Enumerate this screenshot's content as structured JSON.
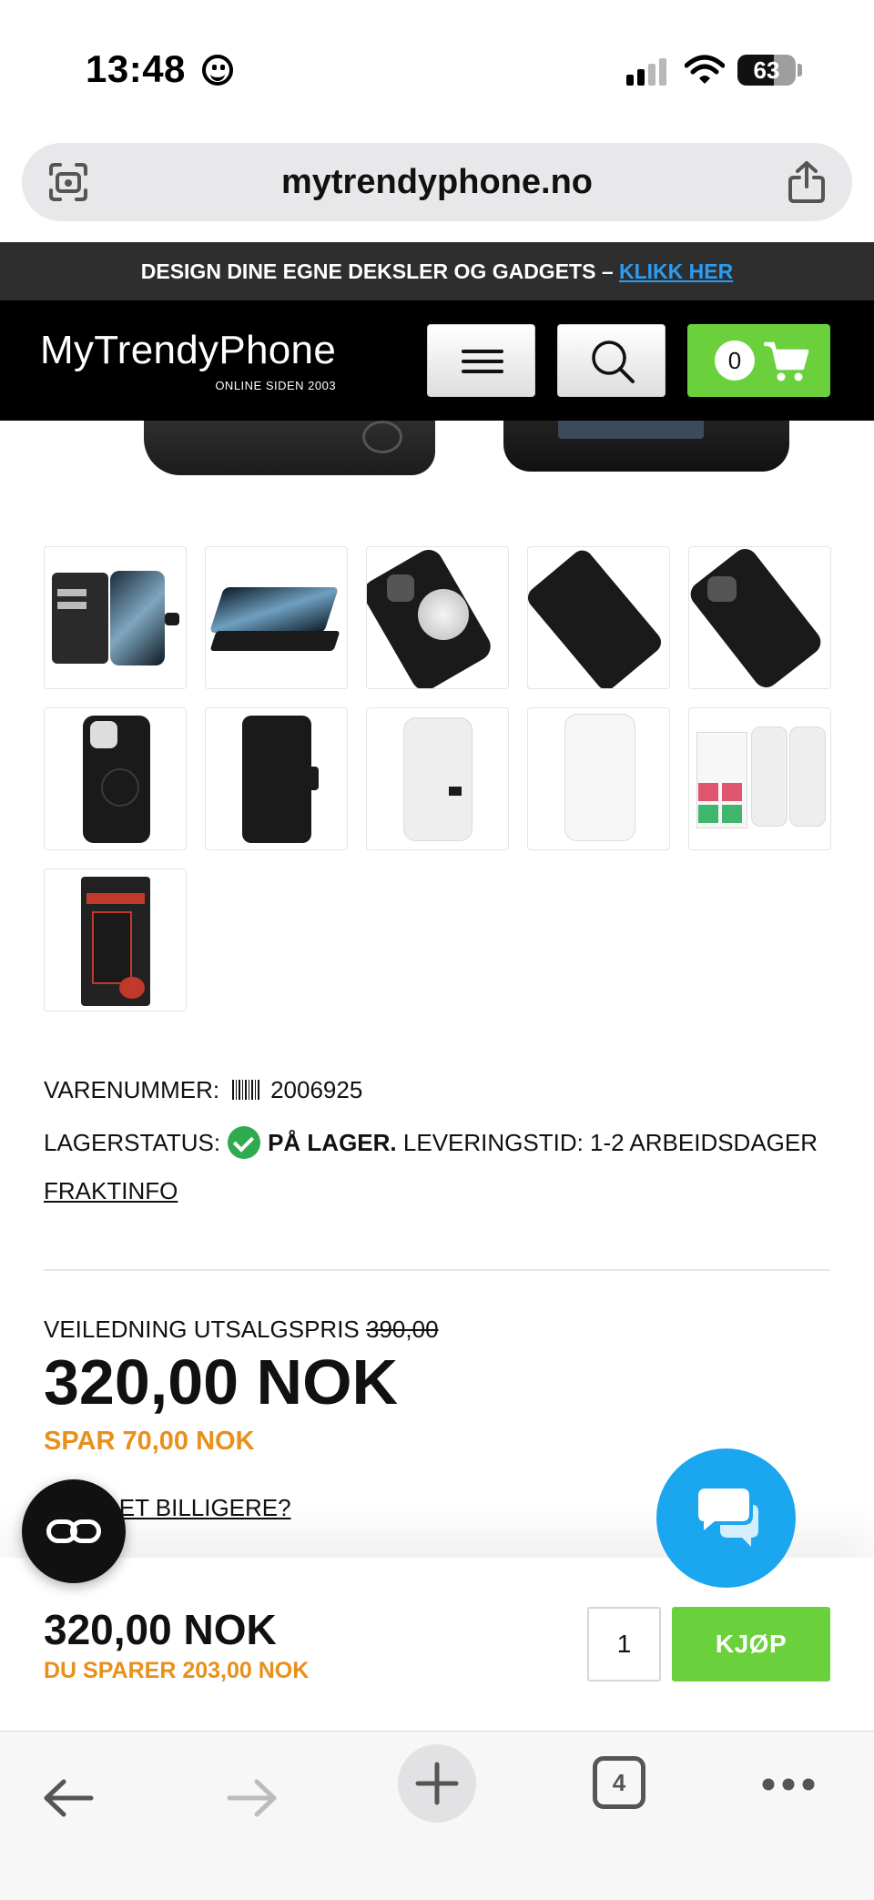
{
  "status_bar": {
    "time": "13:48",
    "battery": "63",
    "battery_level": 0.63
  },
  "browser": {
    "url": "mytrendyphone.no",
    "tab_count": "4"
  },
  "promo": {
    "text": "DESIGN DINE EGNE DEKSLER OG GADGETS – ",
    "link": "KLIKK HER"
  },
  "header": {
    "logo_name": "MyTrendyPhone",
    "logo_tagline": "ONLINE SIDEN 2003",
    "cart_count": "0"
  },
  "thumbnails": [
    {
      "icon": "wallet-open-cards"
    },
    {
      "icon": "wallet-stand"
    },
    {
      "icon": "case-magsafe"
    },
    {
      "icon": "wallet-closed"
    },
    {
      "icon": "case-back"
    },
    {
      "icon": "case-back-ring"
    },
    {
      "icon": "case-closed-front"
    },
    {
      "icon": "screen-protector"
    },
    {
      "icon": "screen-protector-peel"
    },
    {
      "icon": "protector-kit"
    },
    {
      "icon": "retail-box"
    }
  ],
  "product": {
    "sku_label": "VARENUMMER:",
    "sku": "2006925",
    "stock_label": "LAGERSTATUS:",
    "stock_status": "PÅ LAGER.",
    "delivery": "LEVERINGSTID: 1-2 ARBEIDSDAGER",
    "shipping_link": "FRAKTINFO",
    "rrp_label": "VEILEDNING UTSALGSPRIS",
    "rrp_price": "390,00",
    "price": "320,00 NOK",
    "save": "SPAR 70,00 NOK",
    "cheaper_link": "DET BILLIGERE?"
  },
  "buy_bar": {
    "price": "320,00 NOK",
    "save": "DU SPARER 203,00 NOK",
    "quantity": "1",
    "buy_label": "KJØP"
  },
  "colors": {
    "accent_green": "#6ad13c",
    "save_orange": "#e8901a",
    "chat_blue": "#1aa7ef",
    "link_blue": "#2b9cf2"
  }
}
